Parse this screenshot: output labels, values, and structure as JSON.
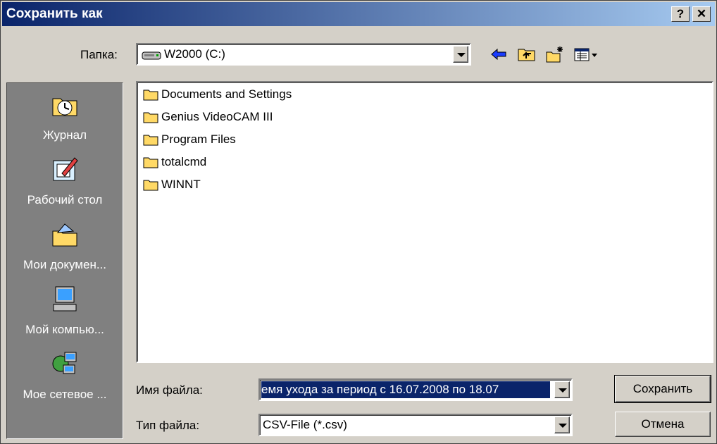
{
  "window": {
    "title": "Сохранить как",
    "help_label": "?",
    "close_label": "✕"
  },
  "folder": {
    "label": "Папка:",
    "current": "W2000 (C:)",
    "icon": "drive-icon"
  },
  "toolbar": {
    "icons": [
      "back-icon",
      "up-folder-icon",
      "new-folder-icon",
      "view-menu-icon"
    ]
  },
  "places": [
    {
      "label": "Журнал",
      "icon": "history-icon"
    },
    {
      "label": "Рабочий стол",
      "icon": "desktop-icon"
    },
    {
      "label": "Мои докумен...",
      "icon": "my-documents-icon"
    },
    {
      "label": "Мой компью...",
      "icon": "my-computer-icon"
    },
    {
      "label": "Мое сетевое ...",
      "icon": "network-icon"
    }
  ],
  "files": [
    {
      "name": "Documents and Settings"
    },
    {
      "name": "Genius VideoCAM III"
    },
    {
      "name": "Program Files"
    },
    {
      "name": "totalcmd"
    },
    {
      "name": "WINNT"
    }
  ],
  "filename": {
    "label": "Имя файла:",
    "value": "емя ухода за период с 16.07.2008  по  18.07"
  },
  "filetype": {
    "label": "Тип файла:",
    "value": "CSV-File (*.csv)"
  },
  "buttons": {
    "save": "Сохранить",
    "cancel": "Отмена"
  },
  "colors": {
    "title_start": "#0a246a",
    "title_end": "#a6caf0",
    "selection": "#0a246a",
    "face": "#d4d0c8"
  }
}
